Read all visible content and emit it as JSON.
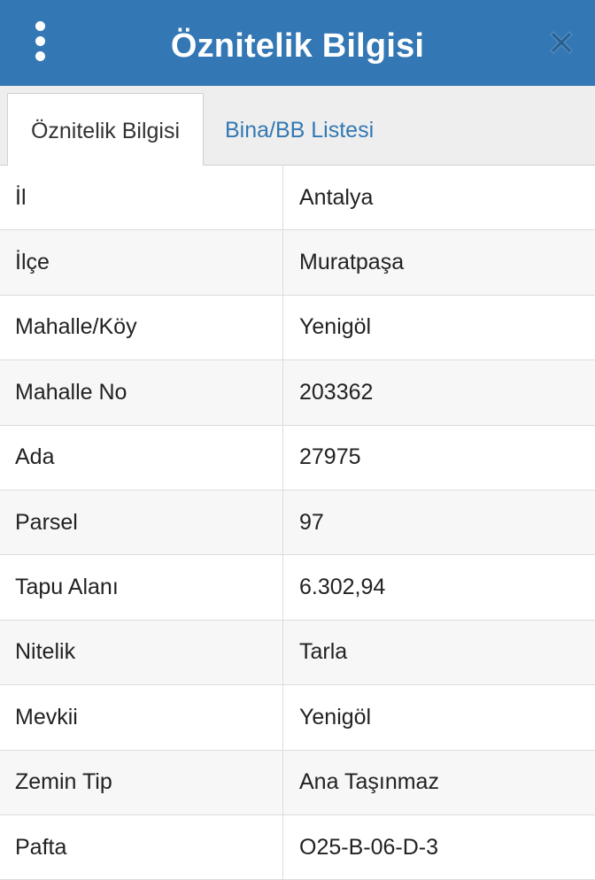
{
  "header": {
    "title": "Öznitelik Bilgisi",
    "menu_icon": "more-vertical-icon",
    "close_icon": "close-icon",
    "background_color": "#3378b4"
  },
  "tabs": [
    {
      "label": "Öznitelik Bilgisi",
      "active": true
    },
    {
      "label": "Bina/BB Listesi",
      "active": false
    }
  ],
  "attributes": [
    {
      "label": "İl",
      "value": "Antalya"
    },
    {
      "label": "İlçe",
      "value": "Muratpaşa"
    },
    {
      "label": "Mahalle/Köy",
      "value": "Yenigöl"
    },
    {
      "label": "Mahalle No",
      "value": "203362"
    },
    {
      "label": "Ada",
      "value": "27975"
    },
    {
      "label": "Parsel",
      "value": "97"
    },
    {
      "label": "Tapu Alanı",
      "value": "6.302,94"
    },
    {
      "label": "Nitelik",
      "value": "Tarla"
    },
    {
      "label": "Mevkii",
      "value": "Yenigöl"
    },
    {
      "label": "Zemin Tip",
      "value": "Ana Taşınmaz"
    },
    {
      "label": "Pafta",
      "value": "O25-B-06-D-3"
    }
  ]
}
